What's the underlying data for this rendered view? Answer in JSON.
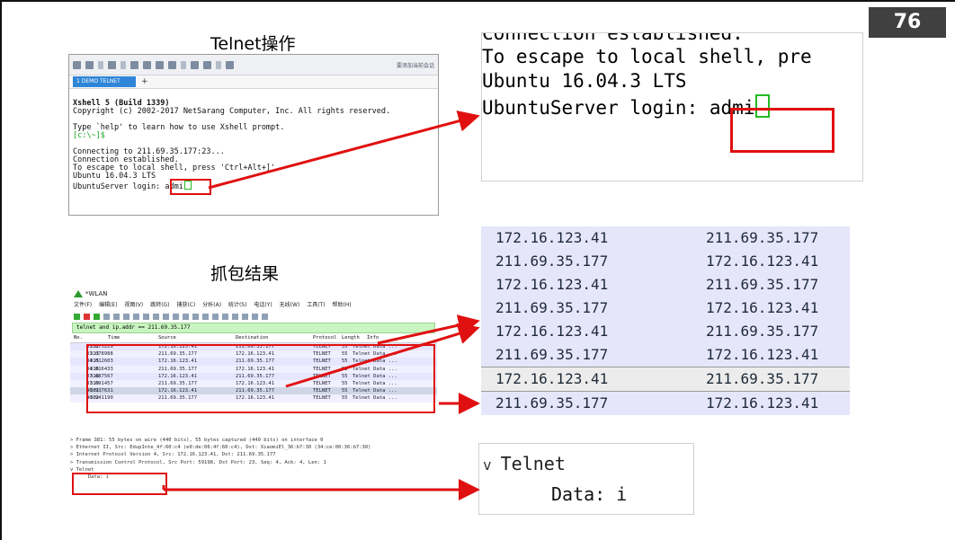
{
  "page_number": "76",
  "titles": {
    "telnet_op": "Telnet操作",
    "capture_result": "抓包结果"
  },
  "xshell": {
    "toolbar_hint": "要添加当前会话",
    "tab_label": "1 DEMO TELNET",
    "tab_plus": "+",
    "lines": [
      "Xshell 5 (Build 1339)",
      "Copyright (c) 2002-2017 NetSarang Computer, Inc. All rights reserved.",
      "",
      "Type `help' to learn how to use Xshell prompt.",
      "[c:\\~]$",
      "",
      "Connecting to 211.69.35.177:23...",
      "Connection established.",
      "To escape to local shell, press 'Ctrl+Alt+]'.",
      "Ubuntu 16.04.3 LTS",
      "UbuntuServer login: "
    ],
    "typed": "admi"
  },
  "zoom_terminal": {
    "lines": [
      "Connection established.",
      "To escape to local shell, pre",
      "Ubuntu 16.04.3 LTS",
      "UbuntuServer login: "
    ],
    "typed": "admi"
  },
  "wireshark": {
    "title": "*WLAN",
    "menu": [
      "文件(F)",
      "编辑(E)",
      "视图(V)",
      "跳转(G)",
      "捕获(C)",
      "分析(A)",
      "统计(S)",
      "电话(Y)",
      "无线(W)",
      "工具(T)",
      "帮助(H)"
    ],
    "filter": "telnet and ip.addr == 211.69.35.177",
    "columns": [
      "No.",
      "Time",
      "Source",
      "Destination",
      "Protocol",
      "Length",
      "Info"
    ],
    "packets": [
      {
        "no": "312",
        "time": "31.075229",
        "src": "172.16.123.41",
        "dst": "211.69.35.177",
        "proto": "TELNET",
        "len": "55",
        "info": "Telnet Data ..."
      },
      {
        "no": "313",
        "time": "31.078988",
        "src": "211.69.35.177",
        "dst": "172.16.123.41",
        "proto": "TELNET",
        "len": "55",
        "info": "Telnet Data ..."
      },
      {
        "no": "315",
        "time": "34.012603",
        "src": "172.16.123.41",
        "dst": "211.69.35.177",
        "proto": "TELNET",
        "len": "55",
        "info": "Telnet Data ..."
      },
      {
        "no": "316",
        "time": "34.016433",
        "src": "211.69.35.177",
        "dst": "172.16.123.41",
        "proto": "TELNET",
        "len": "55",
        "info": "Telnet Data ..."
      },
      {
        "no": "318",
        "time": "37.687567",
        "src": "172.16.123.41",
        "dst": "211.69.35.177",
        "proto": "TELNET",
        "len": "55",
        "info": "Telnet Data ..."
      },
      {
        "no": "319",
        "time": "37.691457",
        "src": "211.69.35.177",
        "dst": "172.16.123.41",
        "proto": "TELNET",
        "len": "55",
        "info": "Telnet Data ..."
      },
      {
        "no": "381",
        "time": "40.937631",
        "src": "172.16.123.41",
        "dst": "211.69.35.177",
        "proto": "TELNET",
        "len": "55",
        "info": "Telnet Data ..."
      },
      {
        "no": "382",
        "time": "40.941190",
        "src": "211.69.35.177",
        "dst": "172.16.123.41",
        "proto": "TELNET",
        "len": "55",
        "info": "Telnet Data ..."
      }
    ],
    "details": [
      "> Frame 381: 55 bytes on wire (440 bits), 55 bytes captured (440 bits) on interface 0",
      "> Ethernet II, Src: EdupInte_4f:60:c4 (e0:de:06:4f:60:c4), Dst: XiaomiEl_36:b7:30 (34:ce:00:36:b7:30)",
      "> Internet Protocol Version 4, Src: 172.16.123.41, Dst: 211.69.35.177",
      "> Transmission Control Protocol, Src Port: 59198, Dst Port: 23, Seq: 4, Ack: 4, Len: 1",
      "v Telnet",
      "      Data: i"
    ]
  },
  "ip_zoom": [
    {
      "src": "172.16.123.41",
      "dst": "211.69.35.177"
    },
    {
      "src": "211.69.35.177",
      "dst": "172.16.123.41"
    },
    {
      "src": "172.16.123.41",
      "dst": "211.69.35.177"
    },
    {
      "src": "211.69.35.177",
      "dst": "172.16.123.41"
    },
    {
      "src": "172.16.123.41",
      "dst": "211.69.35.177"
    },
    {
      "src": "211.69.35.177",
      "dst": "172.16.123.41"
    },
    {
      "src": "172.16.123.41",
      "dst": "211.69.35.177"
    },
    {
      "src": "211.69.35.177",
      "dst": "172.16.123.41"
    }
  ],
  "telnet_zoom": {
    "chevron": "v",
    "label": "Telnet",
    "data": "Data: i"
  },
  "colors": {
    "highlight": "#e01010",
    "page_badge": "#404040",
    "packet_bg": "#e6e6fb",
    "filter_bg": "#c8f5c0"
  }
}
